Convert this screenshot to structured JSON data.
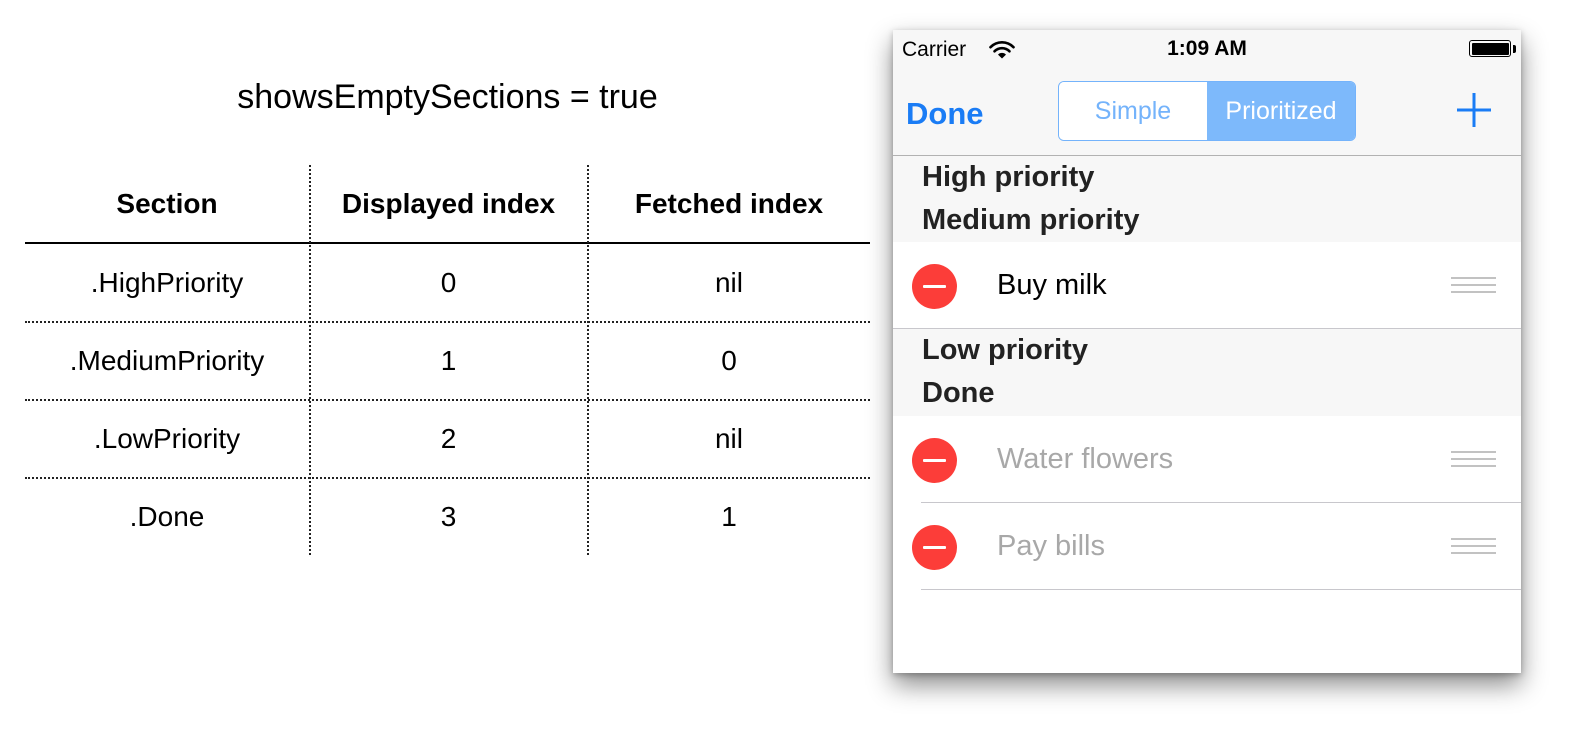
{
  "diagram": {
    "title": "showsEmptySections = true",
    "headers": [
      "Section",
      "Displayed index",
      "Fetched index"
    ],
    "rows": [
      [
        ".HighPriority",
        "0",
        "nil"
      ],
      [
        ".MediumPriority",
        "1",
        "0"
      ],
      [
        ".LowPriority",
        "2",
        "nil"
      ],
      [
        ".Done",
        "3",
        "1"
      ]
    ]
  },
  "status_bar": {
    "carrier": "Carrier",
    "time": "1:09 AM",
    "icons": [
      "wifi-icon",
      "battery-icon"
    ]
  },
  "nav_bar": {
    "done_label": "Done",
    "segments": [
      "Simple",
      "Prioritized"
    ],
    "selected_segment": "Prioritized",
    "add_icon": "plus-icon"
  },
  "table": {
    "headers": {
      "high": "High priority",
      "medium": "Medium priority",
      "low": "Low priority",
      "done": "Done"
    },
    "items": {
      "buy_milk": "Buy milk",
      "water_flowers": "Water flowers",
      "pay_bills": "Pay bills"
    }
  },
  "colors": {
    "tint": "#1a7cf5",
    "segment_selected": "#7db9fb",
    "delete": "#fc3d39",
    "faded_text": "#a8a8a8"
  }
}
